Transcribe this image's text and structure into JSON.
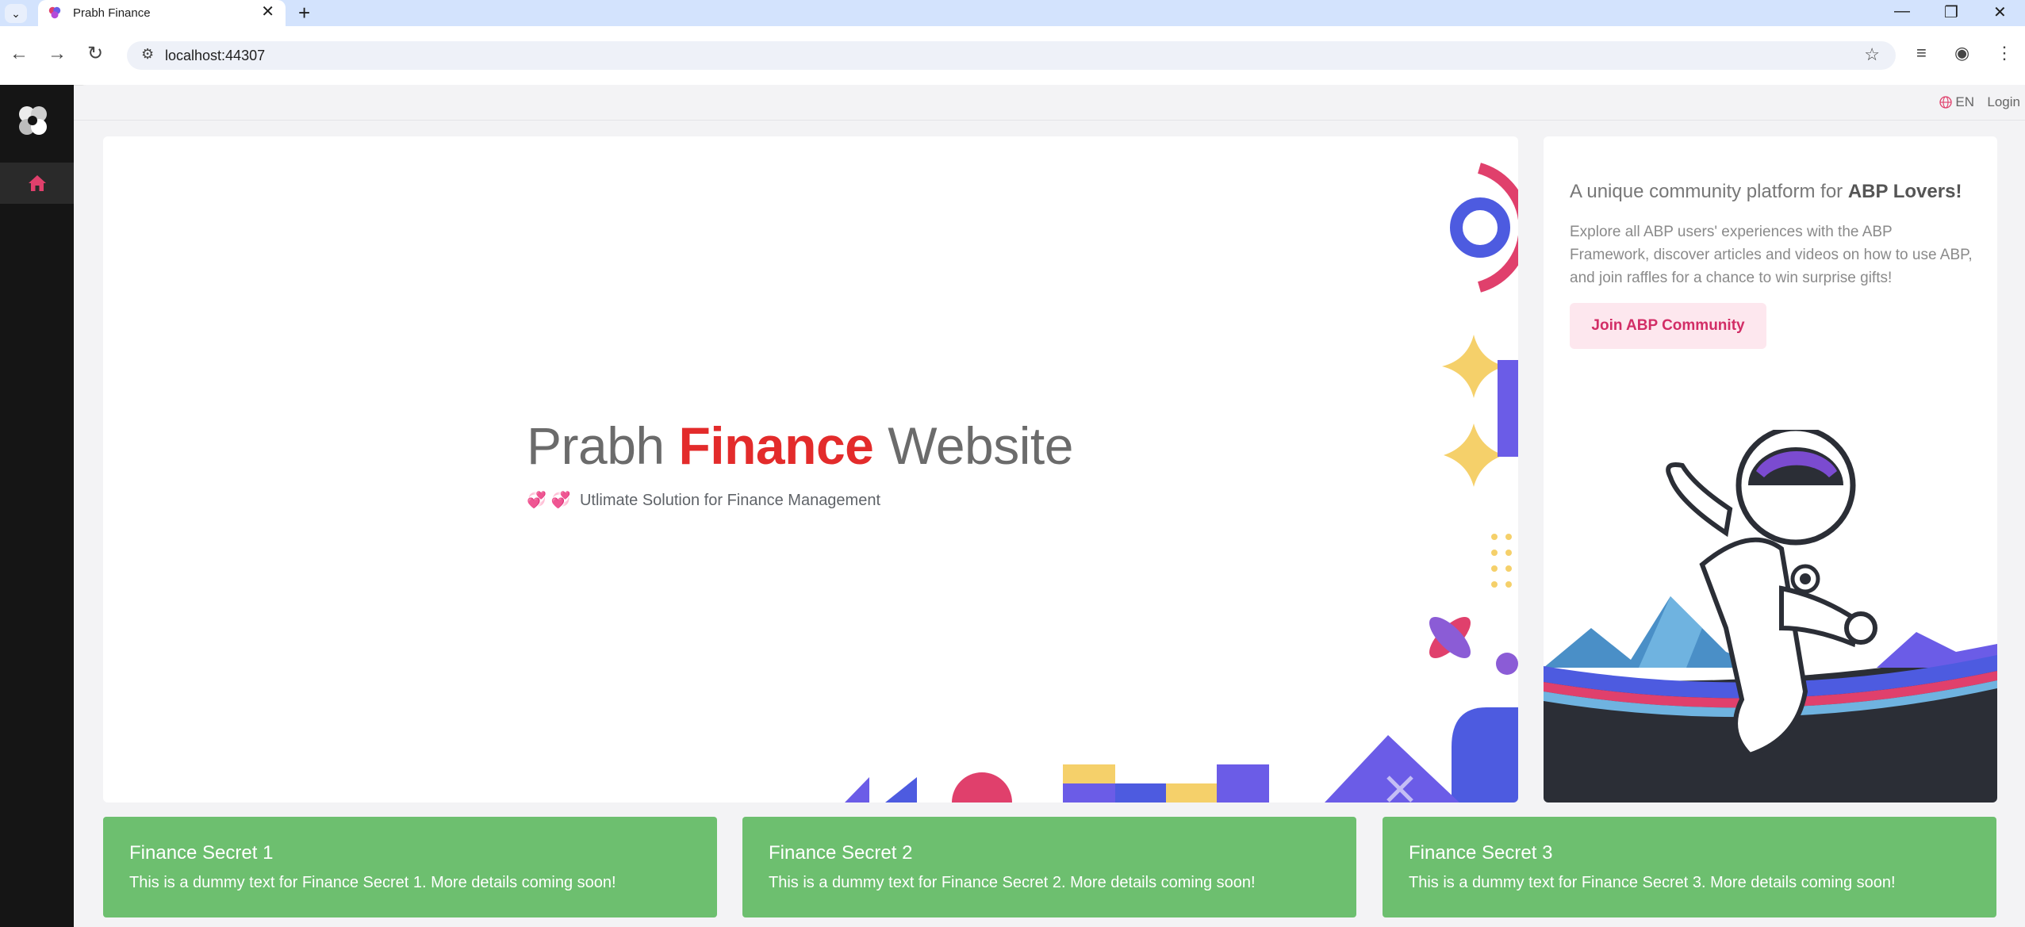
{
  "browser": {
    "tab_title": "Prabh Finance",
    "url": "localhost:44307"
  },
  "header": {
    "language": "EN",
    "login_label": "Login"
  },
  "hero": {
    "title_part1": "Prabh ",
    "title_accent": "Finance",
    "title_part2": " Website",
    "subtitle_emoji": "💞 💞",
    "subtitle": "Utlimate Solution for Finance Management"
  },
  "promo": {
    "title_prefix": "A unique community platform for ",
    "title_bold": "ABP Lovers!",
    "description": "Explore all ABP users' experiences with the ABP Framework, discover articles and videos on how to use ABP, and join raffles for a chance to win surprise gifts!",
    "button_label": "Join ABP Community"
  },
  "cards": [
    {
      "title": "Finance Secret 1",
      "text": "This is a dummy text for Finance Secret 1. More details coming soon!"
    },
    {
      "title": "Finance Secret 2",
      "text": "This is a dummy text for Finance Secret 2. More details coming soon!"
    },
    {
      "title": "Finance Secret 3",
      "text": "This is a dummy text for Finance Secret 3. More details coming soon!"
    }
  ],
  "colors": {
    "accent": "#e32b2b",
    "brand_pink": "#d22d66",
    "card_green": "#6dbf6f",
    "sidebar": "#151515"
  },
  "icons": {
    "sidebar_home": "home-icon",
    "language": "globe-icon"
  }
}
